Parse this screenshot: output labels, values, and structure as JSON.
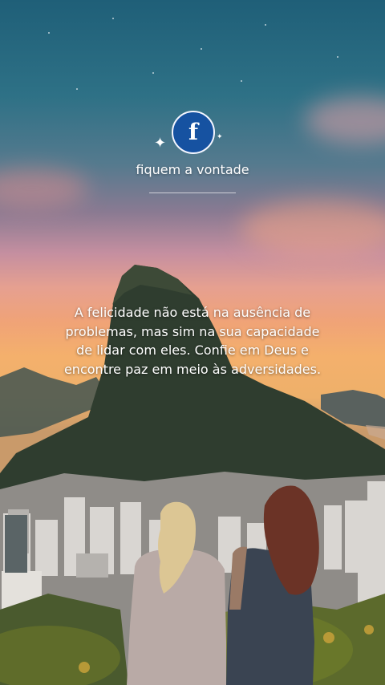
{
  "profile": {
    "icon": "facebook-icon",
    "letter": "f",
    "title": "fiquem a vontade"
  },
  "quote": {
    "text": "A felicidade não está na ausência de problemas, mas sim na sua capacidade de lidar com eles. Confie em Deus e encontre paz em meio às adversidades."
  },
  "colors": {
    "logo_bg": "#1652a1",
    "sky_top": "#1f5f78",
    "sunset": "#f4b06c"
  }
}
